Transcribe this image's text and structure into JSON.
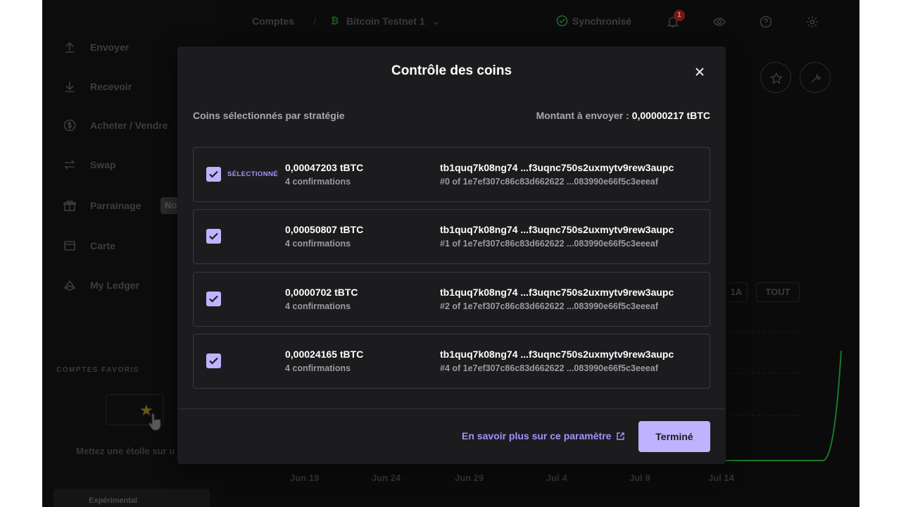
{
  "sidebar": {
    "items": [
      {
        "label": "Envoyer",
        "icon": "arrow-up-icon"
      },
      {
        "label": "Recevoir",
        "icon": "arrow-down-icon"
      },
      {
        "label": "Acheter / Vendre",
        "icon": "dollar-icon"
      },
      {
        "label": "Swap",
        "icon": "swap-icon"
      },
      {
        "label": "Parrainage",
        "icon": "gift-icon"
      },
      {
        "label": "Carte",
        "icon": "card-icon"
      },
      {
        "label": "My Ledger",
        "icon": "ledger-icon"
      }
    ],
    "referral_badge": "No",
    "favorites_title": "COMPTES FAVORIS",
    "favorites_hint": "Mettez une étolle sur u",
    "experimental_label": "Expérimental"
  },
  "topbar": {
    "accounts_label": "Comptes",
    "account_name": "Bitcoin Testnet 1",
    "sync_status": "Synchronisé",
    "notification_count": "1"
  },
  "background": {
    "range_buttons": [
      "1A",
      "TOUT"
    ],
    "dates": [
      "Jun 19",
      "Jun 24",
      "Jun 29",
      "Jul 4",
      "Jul 9",
      "Jul 14"
    ]
  },
  "modal": {
    "title": "Contrôle des coins",
    "strategy_label": "Coins sélectionnés par stratégie",
    "amount_label": "Montant à envoyer : ",
    "amount_value": "0,00000217 tBTC",
    "selected_tag": "SÉLECTIONNÉ",
    "coins": [
      {
        "amount": "0,00047203 tBTC",
        "confirmations": "4 confirmations",
        "address": "tb1quq7k08ng74 ...f3uqnc750s2uxmytv9rew3aupc",
        "tx": "#0 of 1e7ef307c86c83d662622 ...083990e66f5c3eeeaf",
        "checked": true,
        "selected": true
      },
      {
        "amount": "0,00050807 tBTC",
        "confirmations": "4 confirmations",
        "address": "tb1quq7k08ng74 ...f3uqnc750s2uxmytv9rew3aupc",
        "tx": "#1 of 1e7ef307c86c83d662622 ...083990e66f5c3eeeaf",
        "checked": true,
        "selected": false
      },
      {
        "amount": "0,0000702 tBTC",
        "confirmations": "4 confirmations",
        "address": "tb1quq7k08ng74 ...f3uqnc750s2uxmytv9rew3aupc",
        "tx": "#2 of 1e7ef307c86c83d662622 ...083990e66f5c3eeeaf",
        "checked": true,
        "selected": false
      },
      {
        "amount": "0,00024165 tBTC",
        "confirmations": "4 confirmations",
        "address": "tb1quq7k08ng74 ...f3uqnc750s2uxmytv9rew3aupc",
        "tx": "#4 of 1e7ef307c86c83d662622 ...083990e66f5c3eeeaf",
        "checked": true,
        "selected": false
      }
    ],
    "learn_more": "En savoir plus sur ce paramètre",
    "done_label": "Terminé"
  },
  "colors": {
    "accent": "#bfb3ff",
    "accent_text": "#a293ff",
    "modal_bg": "#1c1c1e",
    "app_bg": "#0b0b0c"
  }
}
